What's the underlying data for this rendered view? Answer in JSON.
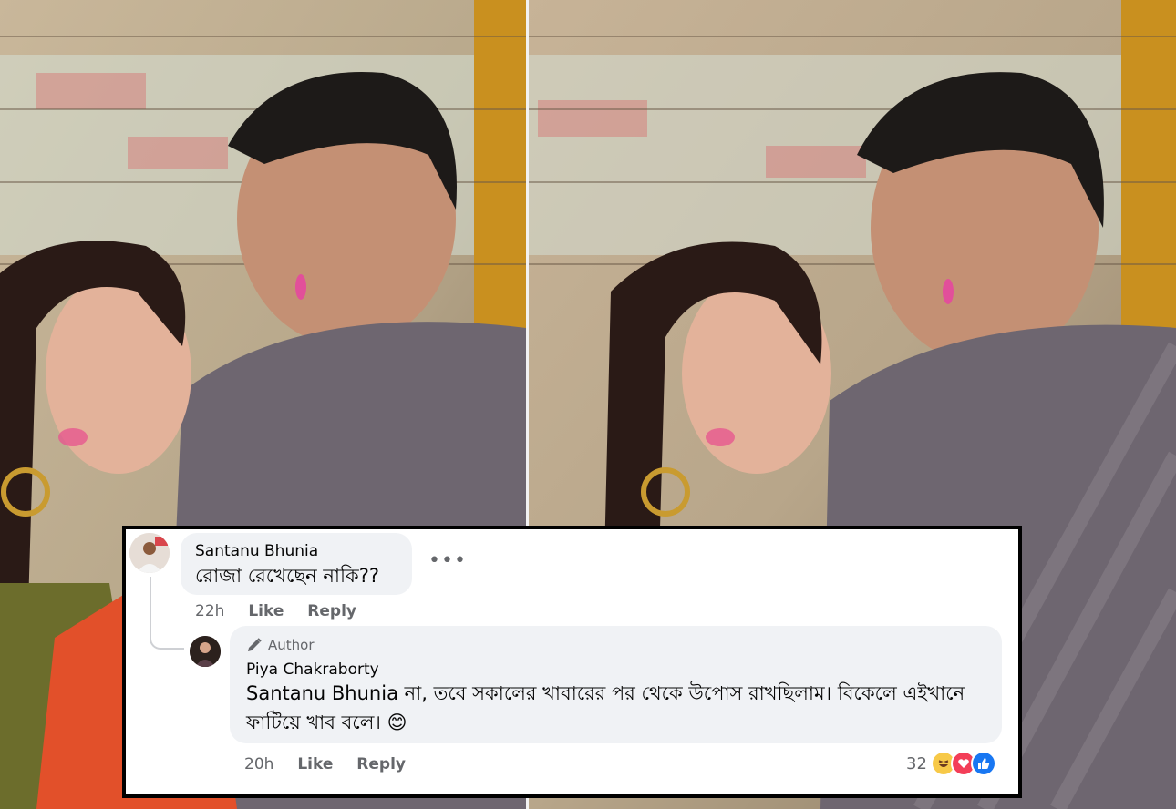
{
  "comment_1": {
    "author": "Santanu Bhunia",
    "text": "রোজা রেখেছেন নাকি??",
    "time": "22h",
    "like_label": "Like",
    "reply_label": "Reply",
    "more_icon": "more-horizontal-icon",
    "more_glyph": "•••"
  },
  "reply_1": {
    "badge_label": "Author",
    "badge_icon": "pencil-icon",
    "author": "Piya Chakraborty",
    "mention": "Santanu Bhunia",
    "text": " না, তবে সকালের খাবারের পর থেকে উপোস রাখছিলাম। বিকেলে এইখানে ফাটিয়ে খাব বলে। 😊",
    "time": "20h",
    "like_label": "Like",
    "reply_label": "Reply",
    "reaction_count": "32",
    "reactions": [
      "haha",
      "love",
      "like"
    ]
  },
  "colors": {
    "bubble": "#f0f2f5",
    "meta_text": "#65676b",
    "panel_border": "#000000"
  }
}
